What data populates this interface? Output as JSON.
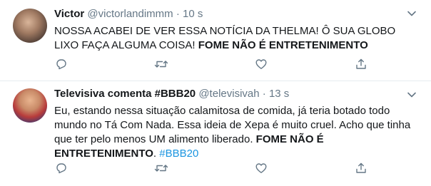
{
  "tweets": [
    {
      "name": "Victor",
      "handle": "@victorlandimmm",
      "dot": "·",
      "time": "10 s",
      "text_plain": "NOSSA ACABEI DE VER ESSA NOTÍCIA DA THELMA! Ô SUA GLOBO LIXO FAÇA ALGUMA COISA! ",
      "text_bold": "FOME NÃO É ENTRETENIMENTO"
    },
    {
      "name": "Televisiva comenta #BBB20",
      "handle": "@televisivah",
      "dot": "·",
      "time": "13 s",
      "text_plain": "Eu, estando nessa situação calamitosa de comida, já teria botado todo mundo no Tá Com Nada. Essa ideia de Xepa é muito cruel. Acho que tinha que ter pelo menos UM alimento liberado. ",
      "text_bold": "FOME NÃO É ENTRETENIMENTO",
      "text_after": ". ",
      "hashtag": "#BBB20"
    }
  ],
  "icons": {
    "reply": "reply-icon",
    "retweet": "retweet-icon",
    "like": "heart-icon",
    "share": "share-icon",
    "more": "chevron-down-icon"
  },
  "colors": {
    "text": "#14171a",
    "muted": "#657786",
    "link": "#1b95e0",
    "divider": "#e6ecf0"
  }
}
